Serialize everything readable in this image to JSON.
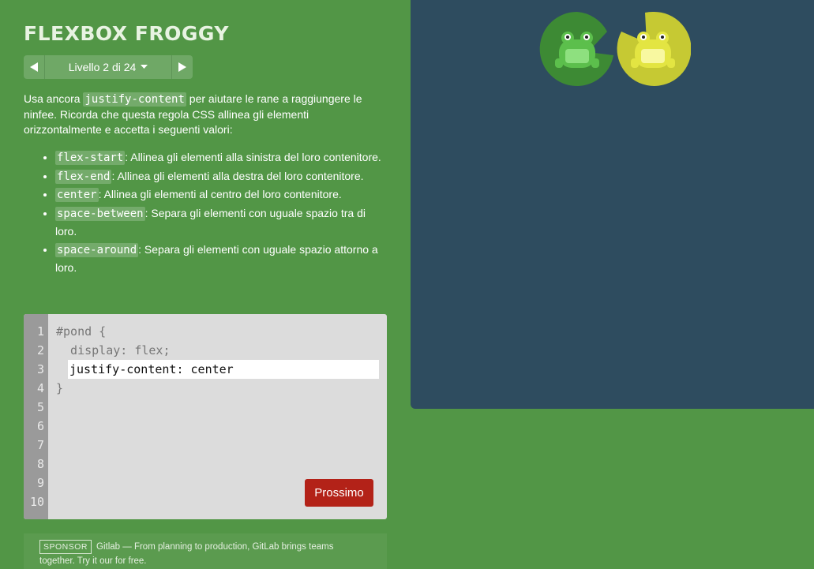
{
  "header": {
    "title": "FLEXBOX FROGGY"
  },
  "level_nav": {
    "prev_icon": "triangle-left",
    "next_icon": "triangle-right",
    "label": "Livello 2 di 24",
    "caret_icon": "caret-down"
  },
  "instructions": {
    "intro_before": "Usa ancora ",
    "intro_code": "justify-content",
    "intro_after": " per aiutare le rane a raggiungere le ninfee. Ricorda che questa regola CSS allinea gli elementi orizzontalmente e accetta i seguenti valori:",
    "values": [
      {
        "code": "flex-start",
        "desc": ": Allinea gli elementi alla sinistra del loro contenitore."
      },
      {
        "code": "flex-end",
        "desc": ": Allinea gli elementi alla destra del loro contenitore."
      },
      {
        "code": "center",
        "desc": ": Allinea gli elementi al centro del loro contenitore."
      },
      {
        "code": "space-between",
        "desc": ": Separa gli elementi con uguale spazio tra di loro."
      },
      {
        "code": "space-around",
        "desc": ": Separa gli elementi con uguale spazio attorno a loro."
      }
    ]
  },
  "editor": {
    "line_numbers": [
      "1",
      "2",
      "3",
      "4",
      "5",
      "6",
      "7",
      "8",
      "9",
      "10"
    ],
    "line1": "#pond {",
    "line2": "  display: flex;",
    "input_value": "justify-content: center",
    "line4": "}",
    "next_button": "Prossimo"
  },
  "sponsor": {
    "badge": "SPONSOR",
    "text": "Gitlab — From planning to production, GitLab brings teams together. Try it our for free."
  },
  "pond": {
    "frogs": [
      {
        "color": "green",
        "pad_color": "#3d8a34",
        "body_color": "#5cbf4c"
      },
      {
        "color": "yellow",
        "pad_color": "#c6c933",
        "body_color": "#e8e84a"
      }
    ]
  },
  "colors": {
    "background": "#529646",
    "pond": "#2e4c5f",
    "next_button": "#b32218",
    "editor": "#dcdcdc",
    "gutter": "#9a9a9a"
  }
}
